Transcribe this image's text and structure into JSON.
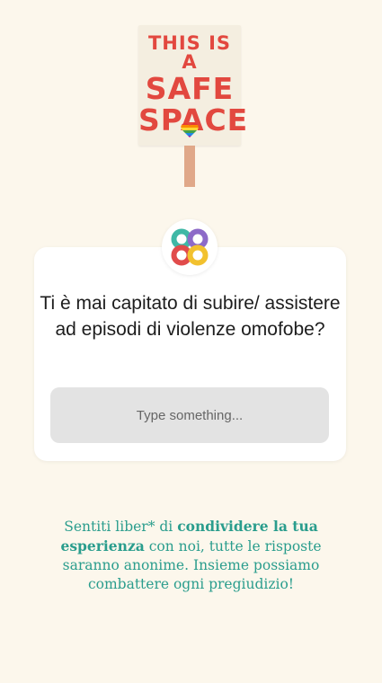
{
  "sign": {
    "line1": "THIS IS A",
    "line2": "SAFE",
    "line3": "SPACE"
  },
  "icons": {
    "heart": "rainbow-heart-icon",
    "app_logo": "app-logo-icon"
  },
  "question_card": {
    "question": "Ti è mai capitato di subire/ assistere ad episodi di violenze omofobe?",
    "input_placeholder": "Type something..."
  },
  "footer": {
    "part1": "Sentiti liber* di ",
    "bold": "condividere la tua esperienza",
    "part2": " con noi, tutte le risposte saranno anonime. Insieme possiamo combattere ogni pregiudizio!"
  },
  "colors": {
    "background": "#fcf7ec",
    "sign_text": "#e2483f",
    "footer_text": "#2a9d8d",
    "logo_teal": "#3fb8a6",
    "logo_purple": "#8d6ac8",
    "logo_red": "#e14b4b",
    "logo_yellow": "#f2c12e"
  }
}
